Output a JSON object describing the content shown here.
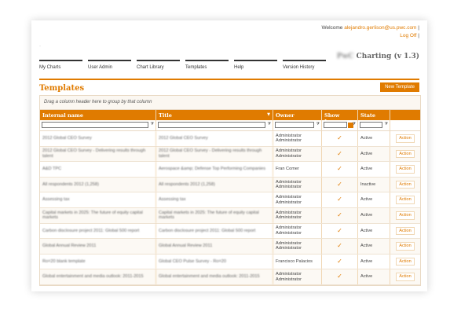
{
  "header": {
    "welcome": "Welcome",
    "email": "alejandro.gerlison@us.pwc.com",
    "bracket_close": "|",
    "logoff": "Log Off",
    "dot": "·",
    "brand_prefix": "PwC",
    "brand_title": "Charting (v 1.3)"
  },
  "nav": [
    "My Charts",
    "User Admin",
    "Chart Library",
    "Templates",
    "Help",
    "Version History"
  ],
  "page": {
    "title": "Templates",
    "new_button": "New Template"
  },
  "grid": {
    "group_hint": "Drag a column header here to group by that column",
    "columns": [
      "Internal name",
      "Title",
      "Owner",
      "Show Logo",
      "State",
      ""
    ],
    "rows": [
      {
        "name": "2012 Global CEO Survey",
        "title": "2012 Global CEO Survey",
        "owner": "Administrator Administrator",
        "logo": "✓",
        "state": "Active",
        "action": "Action"
      },
      {
        "name": "2012 Global CEO Survey - Delivering results through talent",
        "title": "2012 Global CEO Survey - Delivering results through talent",
        "owner": "Administrator Administrator",
        "logo": "✓",
        "state": "Active",
        "action": "Action"
      },
      {
        "name": "A&D TPC",
        "title": "Aerospace &amp; Defense Top Performing Companies",
        "owner": "Fran Comer",
        "logo": "✓",
        "state": "Active",
        "action": "Action"
      },
      {
        "name": "All respondents 2012 (1,258)",
        "title": "All respondents 2012 (1,258)",
        "owner": "Administrator Administrator",
        "logo": "✓",
        "state": "Inactive",
        "action": "Action"
      },
      {
        "name": "Assessing tax",
        "title": "Assessing tax",
        "owner": "Administrator Administrator",
        "logo": "✓",
        "state": "Active",
        "action": "Action"
      },
      {
        "name": "Capital markets in 2025: The future of equity capital markets",
        "title": "Capital markets in 2025: The future of equity capital markets",
        "owner": "Administrator Administrator",
        "logo": "✓",
        "state": "Active",
        "action": "Action"
      },
      {
        "name": "Carbon disclosure project 2011: Global 500 report",
        "title": "Carbon disclosure project 2011: Global 500 report",
        "owner": "Administrator Administrator",
        "logo": "✓",
        "state": "Active",
        "action": "Action"
      },
      {
        "name": "Global Annual Review 2011",
        "title": "Global Annual Review 2011",
        "owner": "Administrator Administrator",
        "logo": "✓",
        "state": "Active",
        "action": "Action"
      },
      {
        "name": "Ro=20 blank template",
        "title": "Global CEO Pulse Survey - Ro=20",
        "owner": "Francisco Palacios",
        "logo": "✓",
        "state": "Active",
        "action": "Action"
      },
      {
        "name": "Global entertainment and media outlook: 2011-2015",
        "title": "Global entertainment and media outlook: 2011-2015",
        "owner": "Administrator Administrator",
        "logo": "✓",
        "state": "Active",
        "action": "Action"
      }
    ]
  },
  "colors": {
    "accent": "#e07b00",
    "border": "#e9d9c4"
  }
}
